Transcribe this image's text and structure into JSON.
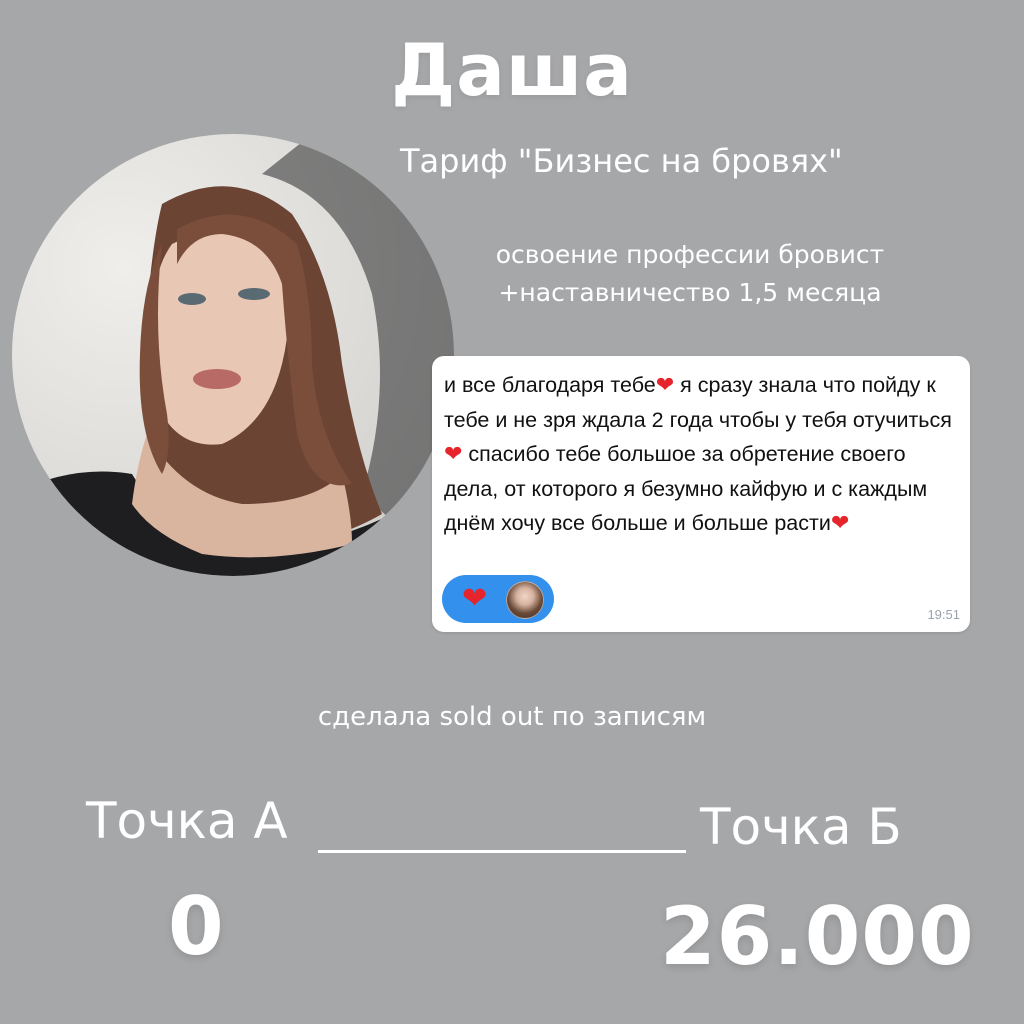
{
  "header": {
    "name": "Даша",
    "tariff": "Тариф \"Бизнес на бровях\"",
    "description_line1": "освоение профессии бровист",
    "description_line2": "+наставничество 1,5 месяца"
  },
  "message": {
    "segments": [
      "и все благодаря тебе",
      " я сразу знала что пойду к тебе и не зря ждала 2 года чтобы у тебя отучиться",
      " спасибо тебе большое за обретение своего дела, от которого я безумно кайфую и с каждым днём хочу все больше и больше расти"
    ],
    "heart_glyph": "❤",
    "time": "19:51",
    "reaction_color": "#3390ec"
  },
  "soldout_text": "сделала sold out по записям",
  "points": {
    "a_label": "Точка А",
    "b_label": "Точка Б",
    "a_value": "0",
    "b_value": "26.000"
  },
  "colors": {
    "background": "#a6a7a9",
    "text": "#ffffff",
    "heart": "#e5252b"
  },
  "icons": {
    "heart": "heart-icon",
    "reaction_avatar": "avatar"
  }
}
